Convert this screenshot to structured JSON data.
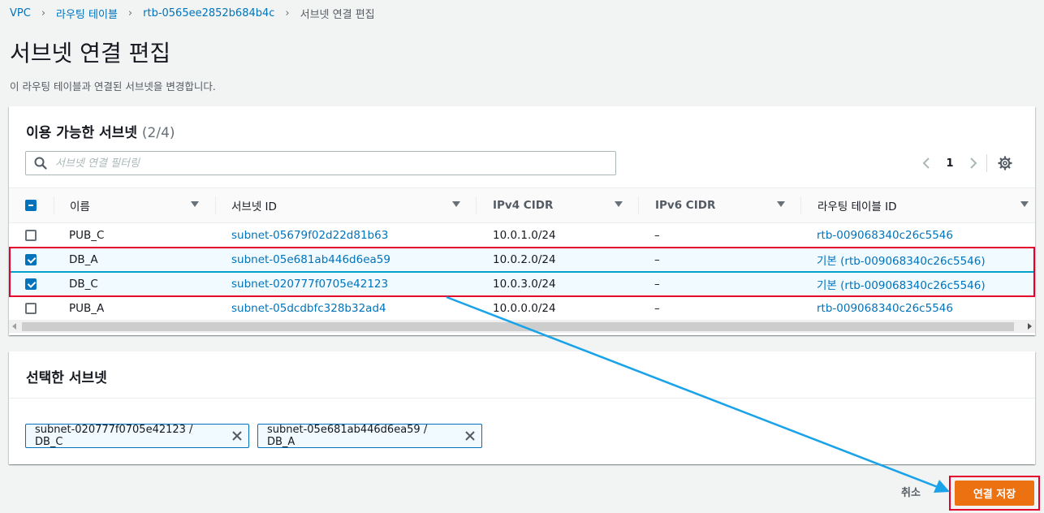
{
  "breadcrumb": {
    "items": [
      "VPC",
      "라우팅 테이블",
      "rtb-0565ee2852b684b4c"
    ],
    "current": "서브넷 연결 편집"
  },
  "page": {
    "title": "서브넷 연결 편집",
    "description": "이 라우팅 테이블과 연결된 서브넷을 변경합니다."
  },
  "available": {
    "title": "이용 가능한 서브넷",
    "count": "(2/4)",
    "filter_placeholder": "서브넷 연결 필터링",
    "page_number": "1",
    "columns": [
      "이름",
      "서브넷 ID",
      "IPv4 CIDR",
      "IPv6 CIDR",
      "라우팅 테이블 ID"
    ],
    "rows": [
      {
        "name": "PUB_C",
        "subnet": "subnet-05679f02d22d81b63",
        "ipv4": "10.0.1.0/24",
        "ipv6": "–",
        "rtb": "rtb-009068340c26c5546",
        "checked": false
      },
      {
        "name": "DB_A",
        "subnet": "subnet-05e681ab446d6ea59",
        "ipv4": "10.0.2.0/24",
        "ipv6": "–",
        "rtb": "기본 (rtb-009068340c26c5546)",
        "checked": true
      },
      {
        "name": "DB_C",
        "subnet": "subnet-020777f0705e42123",
        "ipv4": "10.0.3.0/24",
        "ipv6": "–",
        "rtb": "기본 (rtb-009068340c26c5546)",
        "checked": true
      },
      {
        "name": "PUB_A",
        "subnet": "subnet-05dcdbfc328b32ad4",
        "ipv4": "10.0.0.0/24",
        "ipv6": "–",
        "rtb": "rtb-009068340c26c5546",
        "checked": false
      }
    ]
  },
  "selected": {
    "title": "선택한 서브넷",
    "tokens": [
      "subnet-020777f0705e42123 / DB_C",
      "subnet-05e681ab446d6ea59 / DB_A"
    ]
  },
  "footer": {
    "cancel_label": "취소",
    "save_label": "연결 저장"
  },
  "colors": {
    "link": "#0073bb",
    "primary_button": "#ec7211",
    "highlight_box": "#e4002b",
    "annotation_arrow": "#1aa3e8"
  }
}
